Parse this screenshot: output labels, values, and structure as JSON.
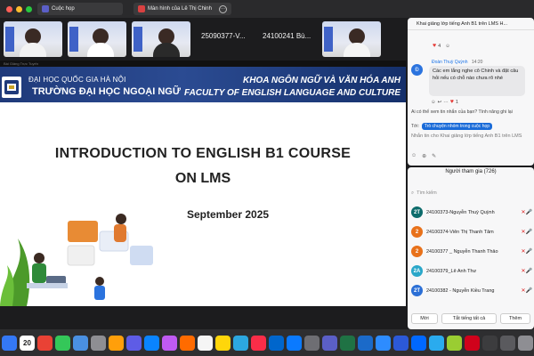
{
  "topbar": {
    "tab1_label": "Cuộc họp",
    "tab2_label": "Màn hình của Lê Thị Chinh",
    "more_label": "···"
  },
  "strip": {
    "tile4_label": "25090377-V...",
    "tile5_label": "24100241 Bù..."
  },
  "slide": {
    "top_strip_text": "Bài Giảng Trực Tuyến",
    "university_line1": "ĐẠI HỌC QUỐC GIA HÀ NỘI",
    "university_line2": "TRƯỜNG ĐẠI HỌC NGOẠI NGỮ",
    "faculty_vi": "KHOA NGÔN NGỮ VÀ VĂN HÓA ANH",
    "faculty_en": "FACULTY OF ENGLISH LANGUAGE AND CULTURE",
    "title_line1": "INTRODUCTION TO ENGLISH B1 COURSE",
    "title_line2": "ON LMS",
    "date": "September 2025"
  },
  "chat": {
    "header": "Khai giảng lớp tiếng Anh B1 trên LMS H...",
    "reaction_count_top": "4",
    "sender": "Đoàn Thuỳ Quỳnh",
    "time": "14:20",
    "avatar_letter": "Đ",
    "message": "Các em lắng nghe cô Chinh và đặt câu hỏi nếu có chỗ nào chưa rõ nhé",
    "reaction_count_msg": "1",
    "ai_prompt": "Ai có thể xem tin nhắn của bạn? Tính năng ghi lại",
    "to_label": "Tới:",
    "to_target": "Trò chuyện nhóm trong cuộc họp",
    "composer_placeholder": "Nhắn tin cho Khai giảng lớp tiếng Anh B1 trên LMS"
  },
  "participants": {
    "header": "Người tham gia (726)",
    "search_placeholder": "Tìm kiếm",
    "rows": [
      {
        "avatar": "2T",
        "name": "24100373-Nguyễn Thuỳ Quỳnh",
        "color": "#0c6b6b"
      },
      {
        "avatar": "2",
        "name": "24100374-Viên Thị Thanh Tâm",
        "color": "#e8711a"
      },
      {
        "avatar": "2",
        "name": "24100377 _ Nguyễn Thanh Thảo",
        "color": "#e8711a"
      },
      {
        "avatar": "2A",
        "name": "24100379_Lê Anh Thư",
        "color": "#2aa7c9"
      },
      {
        "avatar": "2T",
        "name": "24100382 - Nguyễn Kiều Trang",
        "color": "#2b6fd6"
      }
    ],
    "btn_mute": "Mời",
    "btn_mute_all": "Tắt tiếng tất cả",
    "btn_more": "Thêm"
  },
  "dock": {
    "calendar_day": "20"
  },
  "colors": {
    "banner": "#1f3a7a",
    "accent_blue": "#1a6bd8",
    "red_light": "#ff5f57",
    "yellow_light": "#febc2e",
    "green_light": "#28c840"
  }
}
